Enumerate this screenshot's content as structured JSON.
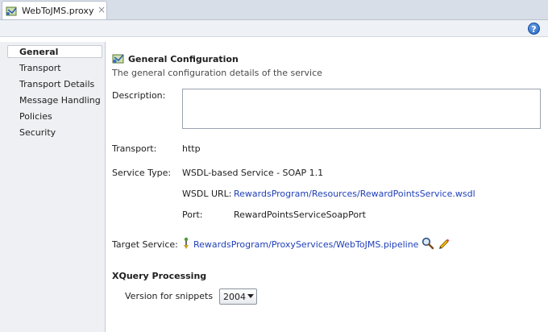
{
  "tab": {
    "title": "WebToJMS.proxy",
    "close": "×"
  },
  "toolbar": {
    "help": "?"
  },
  "sidebar": {
    "items": [
      {
        "label": "General",
        "selected": true
      },
      {
        "label": "Transport"
      },
      {
        "label": "Transport Details"
      },
      {
        "label": "Message Handling"
      },
      {
        "label": "Policies"
      },
      {
        "label": "Security"
      }
    ]
  },
  "general": {
    "title": "General Configuration",
    "subtitle": "The general configuration details of the service",
    "description": {
      "label": "Description:",
      "value": ""
    },
    "transport": {
      "label": "Transport:",
      "value": "http"
    },
    "service_type": {
      "label": "Service Type:",
      "value": "WSDL-based Service - SOAP 1.1",
      "wsdl_url_label": "WSDL URL:",
      "wsdl_url": "RewardsProgram/Resources/RewardPointsService.wsdl",
      "port_label": "Port:",
      "port": "RewardPointsServiceSoapPort"
    },
    "target_service": {
      "label": "Target Service:",
      "value": "RewardsProgram/ProxyServices/WebToJMS.pipeline"
    }
  },
  "xquery": {
    "title": "XQuery Processing",
    "version_label": "Version for snippets",
    "version_value": "2004"
  },
  "icons": [
    "proxy-file-icon",
    "close-icon",
    "help-icon",
    "general-config-icon",
    "target-service-icon",
    "search-icon",
    "edit-icon",
    "dropdown-arrow-icon"
  ]
}
